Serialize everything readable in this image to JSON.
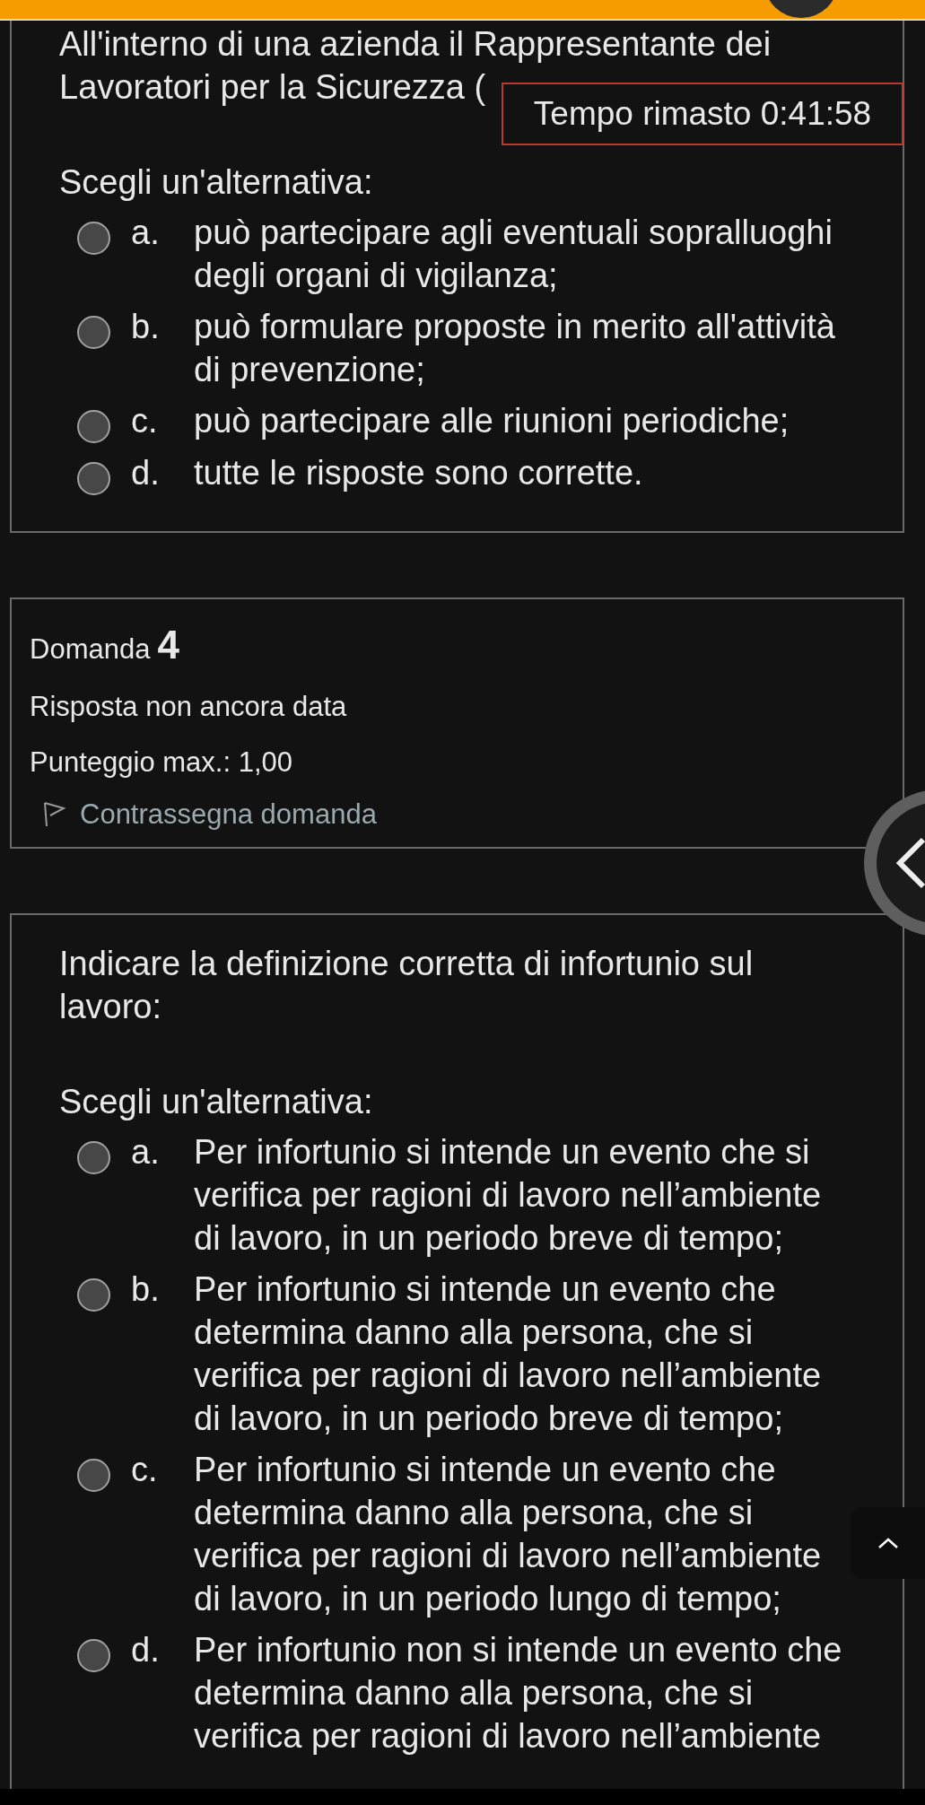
{
  "timer": {
    "text": "Tempo rimasto 0:41:58"
  },
  "blocks": [
    {
      "kind": "question",
      "text": "All'interno di una azienda il Rappresentante dei Lavoratori per la Sicurezza (",
      "continued": true,
      "prompt": "Scegli un'alternativa:",
      "options": [
        {
          "letter": "a.",
          "text": "può partecipare agli eventuali sopralluoghi degli organi di vigilanza;",
          "selected": false
        },
        {
          "letter": "b.",
          "text": "può formulare proposte in merito all'attività di prevenzione;",
          "selected": false
        },
        {
          "letter": "c.",
          "text": "può partecipare alle riunioni periodiche;",
          "selected": false
        },
        {
          "letter": "d.",
          "text": "tutte le risposte sono corrette.",
          "selected": false
        }
      ]
    },
    {
      "kind": "info",
      "title": "Domanda",
      "number": "4",
      "status": "Risposta non ancora data",
      "grade": "Punteggio max.: 1,00",
      "flag": "Contrassegna domanda",
      "flagged": false
    },
    {
      "kind": "question",
      "text": "Indicare la definizione corretta di infortunio sul lavoro:",
      "continued": false,
      "prompt": "Scegli un'alternativa:",
      "options": [
        {
          "letter": "a.",
          "text": "Per infortunio si intende un evento che si verifica per ragioni di lavoro nell’ambiente di lavoro, in un periodo breve di tempo;",
          "selected": false
        },
        {
          "letter": "b.",
          "text": "Per infortunio si intende un evento che determina danno alla persona, che si verifica per ragioni di lavoro nell’ambiente di lavoro, in un periodo breve di tempo;",
          "selected": false
        },
        {
          "letter": "c.",
          "text": "Per infortunio si intende un evento che determina danno alla persona, che si verifica per ragioni di lavoro nell’ambiente di lavoro, in un periodo lungo di tempo;",
          "selected": false
        },
        {
          "letter": "d.",
          "text": "Per infortunio non si intende un evento che determina danno alla persona, che si verifica per ragioni di lavoro nell’ambiente",
          "selected": false
        }
      ]
    }
  ]
}
